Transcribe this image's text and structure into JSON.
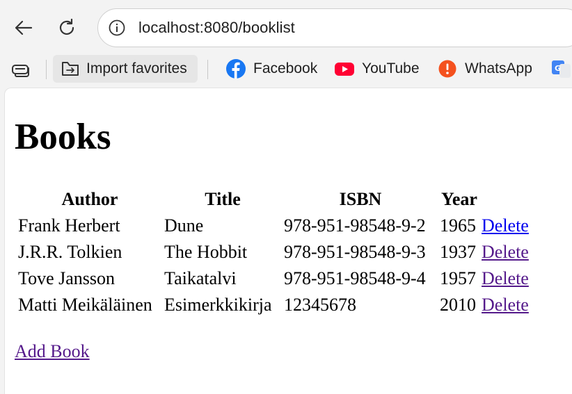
{
  "browser": {
    "url": "localhost:8080/booklist",
    "favorites": [
      {
        "label": "Import favorites",
        "icon": "import-favorites-icon"
      },
      {
        "label": "Facebook",
        "icon": "facebook-icon"
      },
      {
        "label": "YouTube",
        "icon": "youtube-icon"
      },
      {
        "label": "WhatsApp",
        "icon": "whatsapp-icon"
      }
    ]
  },
  "page": {
    "title": "Books",
    "table": {
      "headers": [
        "Author",
        "Title",
        "ISBN",
        "Year",
        ""
      ],
      "rows": [
        {
          "author": "Frank Herbert",
          "title": "Dune",
          "isbn": "978-951-98548-9-2",
          "year": "1965",
          "action": "Delete"
        },
        {
          "author": "J.R.R. Tolkien",
          "title": "The Hobbit",
          "isbn": "978-951-98548-9-3",
          "year": "1937",
          "action": "Delete"
        },
        {
          "author": "Tove Jansson",
          "title": "Taikatalvi",
          "isbn": "978-951-98548-9-4",
          "year": "1957",
          "action": "Delete"
        },
        {
          "author": "Matti Meikäläinen",
          "title": "Esimerkkikirja",
          "isbn": "12345678",
          "year": "2010",
          "action": "Delete"
        }
      ]
    },
    "add_link": "Add Book"
  },
  "colors": {
    "link": "#0000ee",
    "visited_link": "#551a8b",
    "facebook": "#1877f2",
    "youtube": "#ff0033",
    "whatsapp": "#f4511e"
  }
}
